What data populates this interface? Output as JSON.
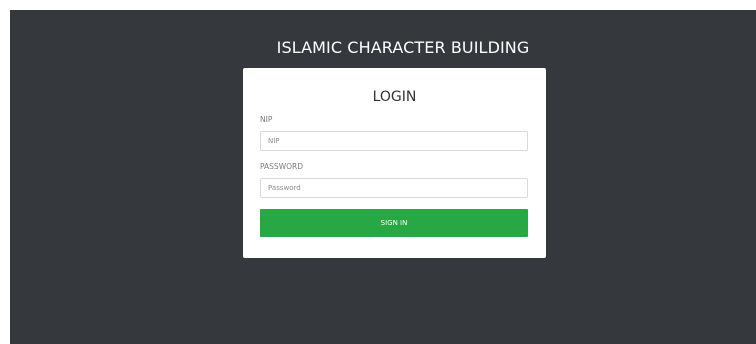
{
  "app": {
    "title": "ISLAMIC CHARACTER BUILDING"
  },
  "login": {
    "heading": "LOGIN",
    "nip": {
      "label": "NIP",
      "placeholder": "NIP",
      "value": ""
    },
    "password": {
      "label": "PASSWORD",
      "placeholder": "Password",
      "value": ""
    },
    "submit_label": "SIGN IN"
  },
  "colors": {
    "background": "#35383d",
    "card": "#ffffff",
    "button": "#28a745"
  }
}
